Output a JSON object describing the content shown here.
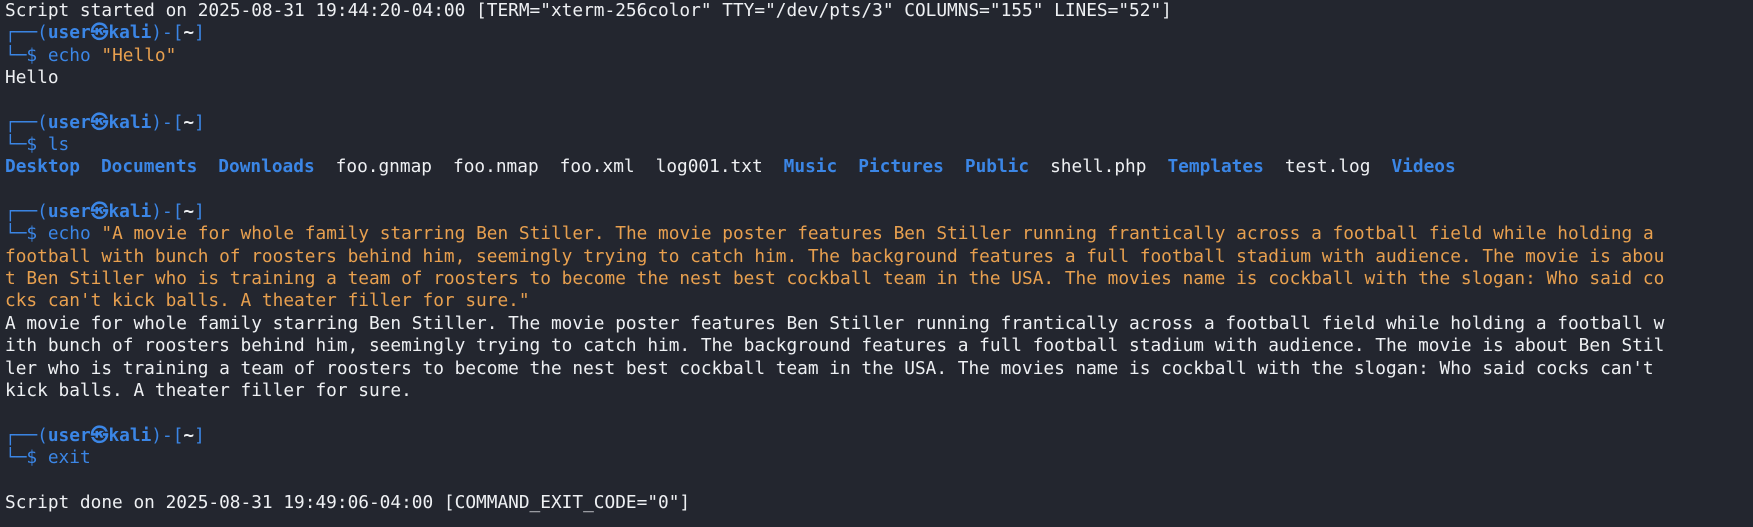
{
  "colors": {
    "background": "#23262f",
    "text": "#eef0f3",
    "prompt_blue": "#3b86e6",
    "string_orange": "#e8a04f"
  },
  "header_line": "Script started on 2025-08-31 19:44:20-04:00 [TERM=\"xterm-256color\" TTY=\"/dev/pts/3\" COLUMNS=\"155\" LINES=\"52\"]",
  "prompt": {
    "frame_top": "┌──(",
    "user": "user",
    "at_icon": "㉿",
    "host": "kali",
    "mid": ")-[",
    "cwd": "~",
    "end": "]",
    "frame_bottom": "└─",
    "dollar": "$ "
  },
  "blocks": [
    {
      "command": "echo",
      "argument": "\"Hello\"",
      "output": [
        "Hello"
      ]
    },
    {
      "command": "ls",
      "argument": "",
      "listing": [
        {
          "name": "Desktop",
          "type": "dir"
        },
        {
          "name": "Documents",
          "type": "dir"
        },
        {
          "name": "Downloads",
          "type": "dir"
        },
        {
          "name": "foo.gnmap",
          "type": "file"
        },
        {
          "name": "foo.nmap",
          "type": "file"
        },
        {
          "name": "foo.xml",
          "type": "file"
        },
        {
          "name": "log001.txt",
          "type": "file"
        },
        {
          "name": "Music",
          "type": "dir"
        },
        {
          "name": "Pictures",
          "type": "dir"
        },
        {
          "name": "Public",
          "type": "dir"
        },
        {
          "name": "shell.php",
          "type": "file"
        },
        {
          "name": "Templates",
          "type": "dir"
        },
        {
          "name": "test.log",
          "type": "file"
        },
        {
          "name": "Videos",
          "type": "dir"
        }
      ]
    },
    {
      "command": "echo",
      "argument_lines": [
        "\"A movie for whole family starring Ben Stiller. The movie poster features Ben Stiller running frantically across a football field while holding a",
        "football with bunch of roosters behind him, seemingly trying to catch him. The background features a full football stadium with audience. The movie is abou",
        "t Ben Stiller who is training a team of roosters to become the nest best cockball team in the USA. The movies name is cockball with the slogan: Who said co",
        "cks can't kick balls. A theater filler for sure.\""
      ],
      "output": [
        "A movie for whole family starring Ben Stiller. The movie poster features Ben Stiller running frantically across a football field while holding a football w",
        "ith bunch of roosters behind him, seemingly trying to catch him. The background features a full football stadium with audience. The movie is about Ben Stil",
        "ler who is training a team of roosters to become the nest best cockball team in the USA. The movies name is cockball with the slogan: Who said cocks can't",
        "kick balls. A theater filler for sure."
      ]
    },
    {
      "command": "exit",
      "argument": ""
    }
  ],
  "footer_line": "Script done on 2025-08-31 19:49:06-04:00 [COMMAND_EXIT_CODE=\"0\"]"
}
